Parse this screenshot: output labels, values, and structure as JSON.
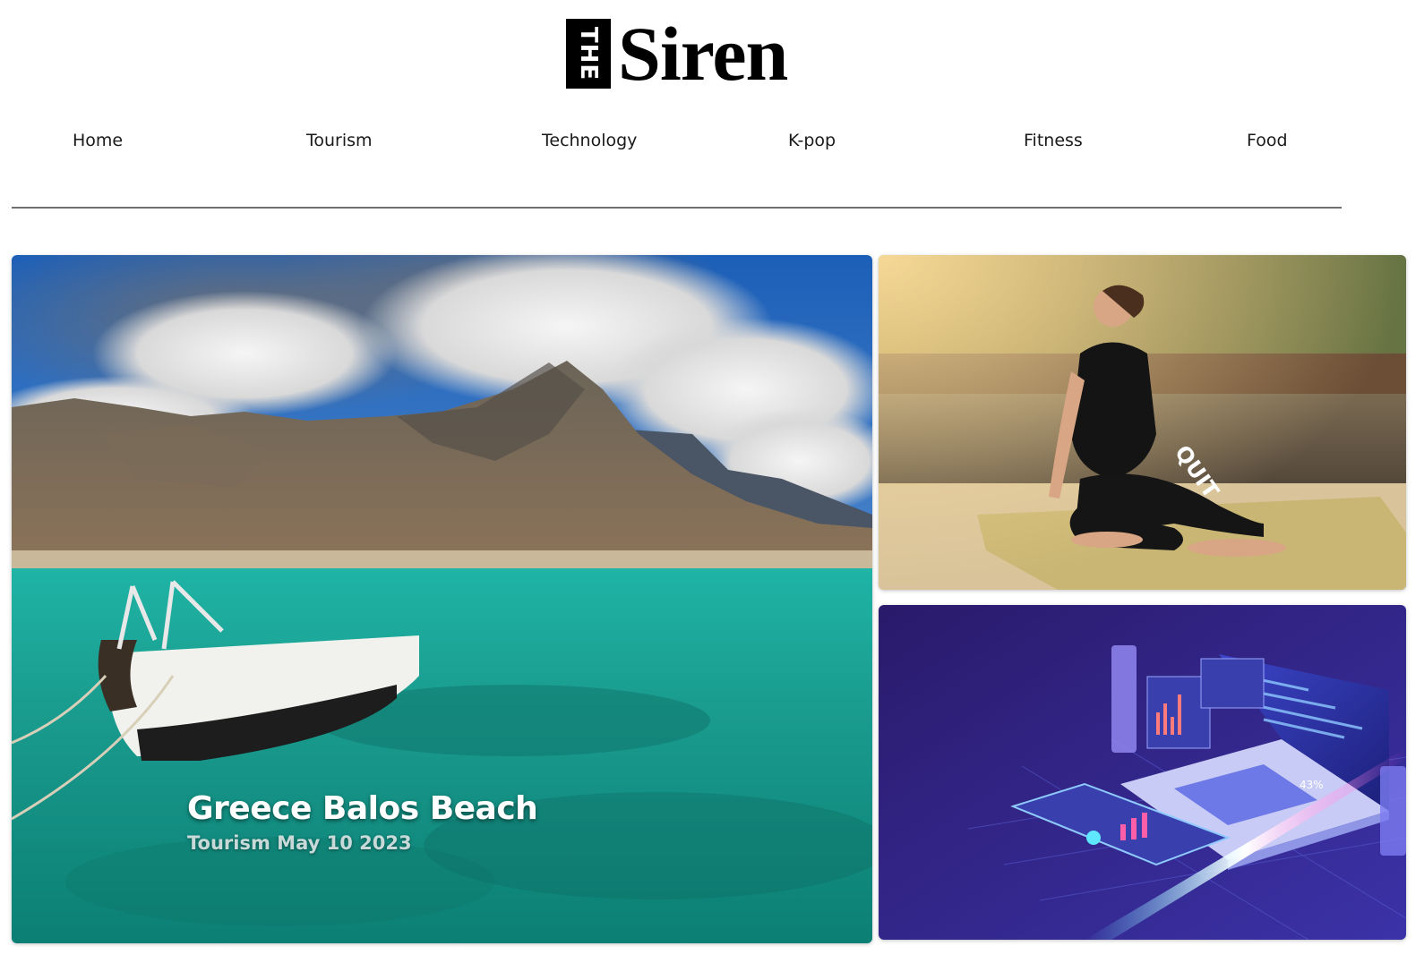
{
  "logo": {
    "mark_text": "THE",
    "word": "Siren"
  },
  "nav": {
    "items": [
      "Home",
      "Tourism",
      "Technology",
      "K-pop",
      "Fitness",
      "Food"
    ]
  },
  "featured": {
    "title": "Greece Balos Beach",
    "category": "Tourism",
    "date": "May 10 2023",
    "image_icon": "boat-beach-photo"
  },
  "side_articles": [
    {
      "image_icon": "yoga-woman-photo",
      "shirt_text": "QUIT"
    },
    {
      "image_icon": "isometric-laptop-tech-photo",
      "stat_text": "43%"
    }
  ]
}
